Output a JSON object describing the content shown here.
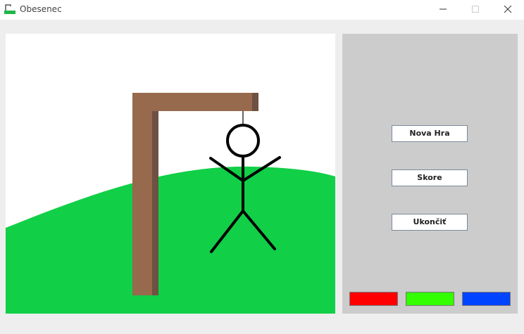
{
  "window": {
    "title": "Obesenec",
    "controls": [
      "minimize-icon",
      "maximize-icon",
      "close-icon"
    ]
  },
  "scene": {
    "sky_color": "#ffffff",
    "hill_color": "#11cf47",
    "gallows_color": "#97694d",
    "gallows_shadow_color": "#6e5143",
    "stick_figure_color": "#000000"
  },
  "side_panel": {
    "background": "#cccccc",
    "buttons": {
      "new_game": "Nova Hra",
      "score": "Skore",
      "quit": "Ukončiť"
    },
    "color_swatches": [
      {
        "name": "red",
        "color": "#ff0000"
      },
      {
        "name": "green",
        "color": "#33ff00"
      },
      {
        "name": "blue",
        "color": "#0044ff"
      }
    ]
  }
}
